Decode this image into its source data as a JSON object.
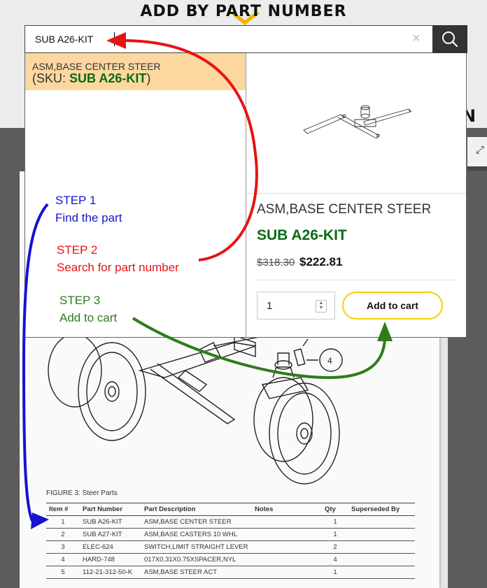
{
  "heading": "ADD BY PART NUMBER",
  "edge_letter": "N",
  "search": {
    "value": "SUB A26-KIT",
    "clear_glyph": "×"
  },
  "result": {
    "name": "ASM,BASE CENTER STEER",
    "sku_prefix": "(SKU: ",
    "sku": "SUB A26-KIT",
    "sku_suffix": ")"
  },
  "product": {
    "title": "ASM,BASE CENTER STEER",
    "sku": "SUB A26-KIT",
    "price_old": "$318.30",
    "price_new": "$222.81",
    "quantity": "1",
    "add_to_cart": "Add to cart"
  },
  "steps": [
    {
      "title": "STEP 1",
      "text": "Find the part",
      "color": "#1414d2"
    },
    {
      "title": "STEP 2",
      "text": "Search for part number",
      "color": "#e61414"
    },
    {
      "title": "STEP 3",
      "text": "Add to cart",
      "color": "#2e7d1a"
    }
  ],
  "figure": {
    "callout": "4",
    "caption": "FIGURE 3: Steer Parts"
  },
  "parts_table": {
    "headers": [
      "Item #",
      "Part Number",
      "Part Description",
      "Notes",
      "Qty",
      "Superseded By"
    ],
    "rows": [
      [
        "1",
        "SUB A26-KIT",
        "ASM,BASE CENTER STEER",
        "",
        "1",
        ""
      ],
      [
        "2",
        "SUB A27-KIT",
        "ASM,BASE CASTERS 10 WHL",
        "",
        "1",
        ""
      ],
      [
        "3",
        "ELEC-624",
        "SWITCH,LIMIT STRAIGHT LEVER",
        "",
        "2",
        ""
      ],
      [
        "4",
        "HARD-748",
        "017X0.31X0.75XSPACER,NYL",
        "",
        "4",
        ""
      ],
      [
        "5",
        "112-21-312-50-K",
        "ASM,BASE STEER ACT",
        "",
        "1",
        ""
      ]
    ]
  },
  "colors": {
    "sku_green": "#0c6a14",
    "highlight": "#fcd8a0",
    "button_border": "#f2d100",
    "search_button": "#333333"
  },
  "icons": [
    "search-icon",
    "close-icon",
    "expand-icon",
    "stepper-icon"
  ]
}
